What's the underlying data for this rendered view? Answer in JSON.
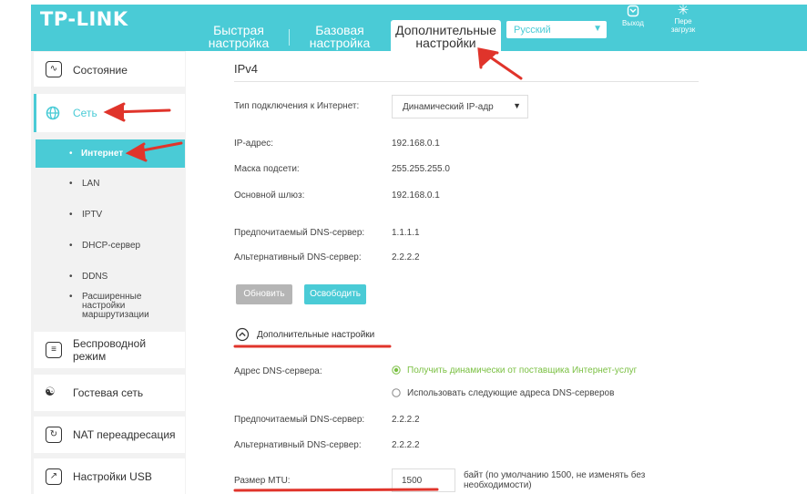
{
  "header": {
    "logo": "TP-LINK",
    "tabs": [
      {
        "line1": "Быстрая",
        "line2": "настройка"
      },
      {
        "line1": "Базовая",
        "line2": "настройка"
      },
      {
        "line1": "Дополнительные",
        "line2": "настройки"
      }
    ],
    "language": "Русский",
    "logout": "Выход",
    "reboot_line1": "Пере",
    "reboot_line2": "загрузк"
  },
  "sidebar": {
    "status": "Состояние",
    "network": "Сеть",
    "sub": [
      "Интернет",
      "LAN",
      "IPTV",
      "DHCP-сервер",
      "DDNS"
    ],
    "routing": [
      "Расширенные",
      "настройки",
      "маршрутизации"
    ],
    "wireless": [
      "Беспроводной",
      "режим"
    ],
    "guest": "Гостевая сеть",
    "nat": "NAT переадресация",
    "usb": "Настройки USB"
  },
  "main": {
    "section": "IPv4",
    "conn_label": "Тип подключения к Интернет:",
    "conn_value": "Динамический IP-адр",
    "ip_label": "IP-адрес:",
    "ip_value": "192.168.0.1",
    "mask_label": "Маска подсети:",
    "mask_value": "255.255.255.0",
    "gw_label": "Основной шлюз:",
    "gw_value": "192.168.0.1",
    "dns1_label": "Предпочитаемый DNS-сервер:",
    "dns1_value": "1.1.1.1",
    "dns2_label": "Альтернативный DNS-сервер:",
    "dns2_value": "2.2.2.2",
    "renew": "Обновить",
    "release": "Освободить",
    "advanced": "Дополнительные настройки",
    "dns_addr_label": "Адрес DNS-сервера:",
    "dns_opt_auto": "Получить динамически от поставщика Интернет-услуг",
    "dns_opt_manual": "Использовать следующие адреса DNS-серверов",
    "dns3_label": "Предпочитаемый DNS-сервер:",
    "dns3_value": "2.2.2.2",
    "dns4_label": "Альтернативный DNS-сервер:",
    "dns4_value": "2.2.2.2",
    "mtu_label": "Размер MTU:",
    "mtu_value": "1500",
    "mtu_note1": "байт (по умолчанию 1500, не изменять без",
    "mtu_note2": "необходимости)"
  },
  "colors": {
    "accent": "#4acbd6",
    "annotation": "#e0342b",
    "button_gray": "#b5b5b5"
  }
}
